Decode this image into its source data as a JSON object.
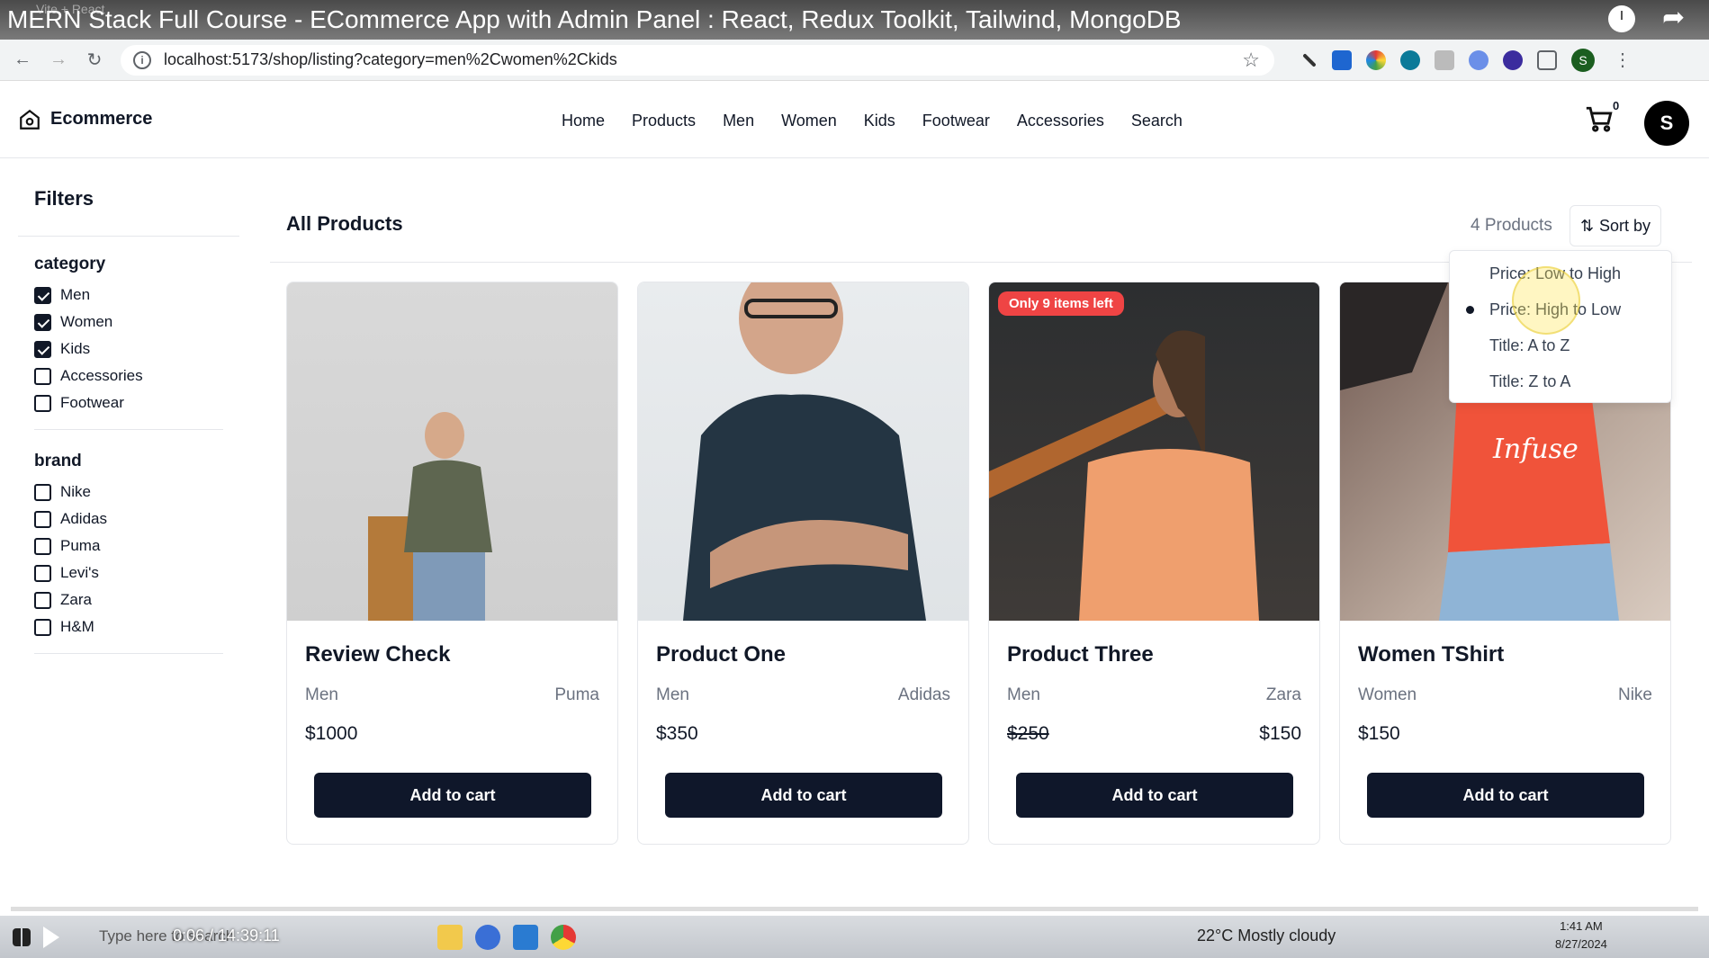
{
  "video": {
    "title": "MERN Stack Full Course - ECommerce App with Admin Panel : React, Redux Toolkit, Tailwind, MongoDB",
    "ghost_tab": "Vite + React",
    "timestamp": "0:06 / 14:39:11"
  },
  "browser": {
    "url": "localhost:5173/shop/listing?category=men%2Cwomen%2Ckids",
    "profile_initial": "S"
  },
  "header": {
    "brand": "Ecommerce",
    "nav": [
      "Home",
      "Products",
      "Men",
      "Women",
      "Kids",
      "Footwear",
      "Accessories",
      "Search"
    ],
    "cart_count": "0",
    "avatar_initial": "S"
  },
  "filters": {
    "title": "Filters",
    "groups": [
      {
        "name": "category",
        "options": [
          {
            "label": "Men",
            "checked": true
          },
          {
            "label": "Women",
            "checked": true
          },
          {
            "label": "Kids",
            "checked": true
          },
          {
            "label": "Accessories",
            "checked": false
          },
          {
            "label": "Footwear",
            "checked": false
          }
        ]
      },
      {
        "name": "brand",
        "options": [
          {
            "label": "Nike",
            "checked": false
          },
          {
            "label": "Adidas",
            "checked": false
          },
          {
            "label": "Puma",
            "checked": false
          },
          {
            "label": "Levi's",
            "checked": false
          },
          {
            "label": "Zara",
            "checked": false
          },
          {
            "label": "H&M",
            "checked": false
          }
        ]
      }
    ]
  },
  "listing": {
    "title": "All Products",
    "count_label": "4 Products",
    "sort_label": "Sort by",
    "sort_options": [
      {
        "label": "Price: Low to High",
        "selected": false
      },
      {
        "label": "Price: High to Low",
        "selected": true
      },
      {
        "label": "Title: A to Z",
        "selected": false
      },
      {
        "label": "Title: Z to A",
        "selected": false
      }
    ],
    "add_to_cart_label": "Add to cart",
    "products": [
      {
        "name": "Review Check",
        "category": "Men",
        "brand": "Puma",
        "price": "$1000",
        "sale_price": "",
        "badge": ""
      },
      {
        "name": "Product One",
        "category": "Men",
        "brand": "Adidas",
        "price": "$350",
        "sale_price": "",
        "badge": ""
      },
      {
        "name": "Product Three",
        "category": "Men",
        "brand": "Zara",
        "price": "$250",
        "sale_price": "$150",
        "badge": "Only 9 items left"
      },
      {
        "name": "Women TShirt",
        "category": "Women",
        "brand": "Nike",
        "price": "$150",
        "sale_price": "",
        "badge": ""
      }
    ]
  },
  "taskbar": {
    "search_placeholder": "Type here to search",
    "weather": "22°C  Mostly cloudy",
    "time": "1:41 AM",
    "date": "8/27/2024"
  },
  "colors": {
    "primary": "#0f172a",
    "badge": "#ef4444",
    "muted": "#6b7280"
  }
}
